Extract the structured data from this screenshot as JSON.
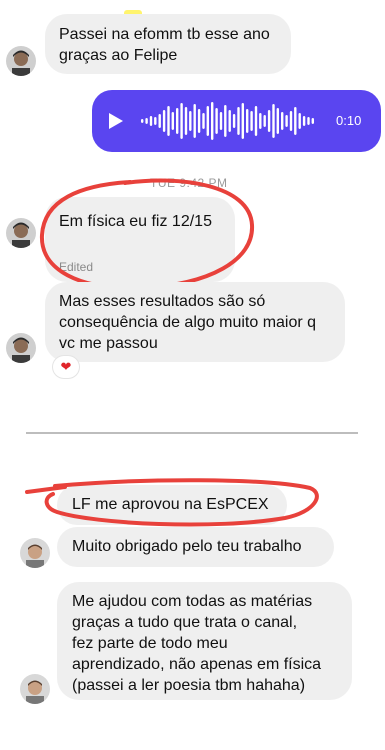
{
  "top_chat": {
    "messages": [
      {
        "lines": [
          "Passei na efomm tb esse ano",
          "graças ao Felipe"
        ]
      },
      {
        "audio": {
          "duration": "0:10",
          "icon": "play-icon"
        }
      },
      {
        "timestamp": "TUE 9:42 PM"
      },
      {
        "lines": [
          "Em física eu fiz 12/15"
        ],
        "edited": "Edited"
      },
      {
        "lines": [
          "Mas esses resultados são só",
          "consequência de algo muito maior q",
          "vc me passou"
        ],
        "reaction": "❤"
      }
    ]
  },
  "bottom_chat": {
    "messages": [
      {
        "lines": [
          "LF me aprovou na EsPCEX"
        ]
      },
      {
        "lines": [
          "Muito obrigado pelo teu trabalho"
        ]
      },
      {
        "lines": [
          "Me ajudou com todas as matérias",
          "graças a tudo que trata o canal,",
          "fez parte de todo meu",
          "aprendizado, não apenas em física",
          "(passei a ler poesia tbm hahaha)"
        ]
      }
    ]
  },
  "colors": {
    "audio_bubble": "#5a45f0",
    "incoming_bubble": "#efefef",
    "annotation_red": "#e8413b",
    "highlight_yellow": "#fff03c"
  }
}
